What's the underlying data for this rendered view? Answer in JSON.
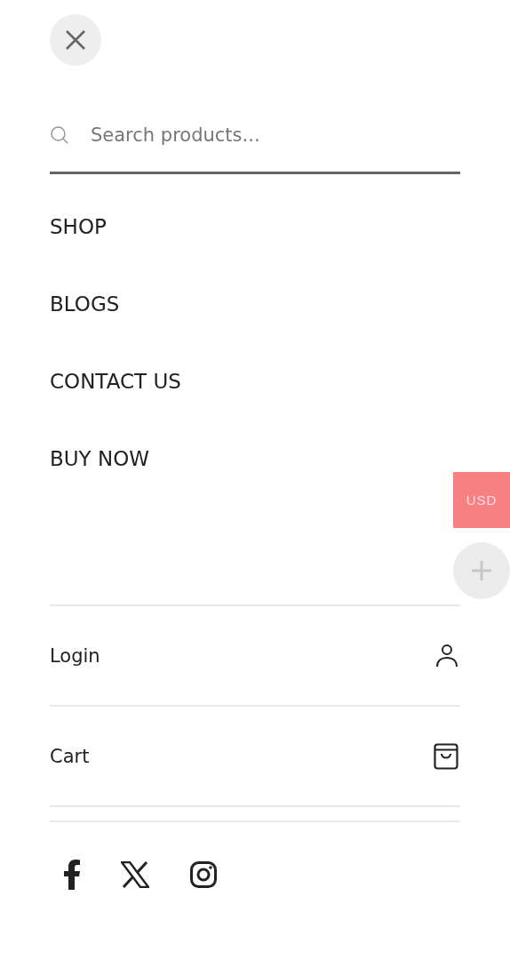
{
  "search": {
    "placeholder": "Search products..."
  },
  "menu": [
    {
      "label": "SHOP"
    },
    {
      "label": "BLOGS"
    },
    {
      "label": "CONTACT US"
    },
    {
      "label": "BUY NOW"
    }
  ],
  "account": [
    {
      "label": "Login",
      "kind": "user"
    },
    {
      "label": "Cart",
      "kind": "bag"
    }
  ],
  "social": [
    {
      "kind": "facebook"
    },
    {
      "kind": "x"
    },
    {
      "kind": "instagram"
    }
  ],
  "currency": {
    "label": "USD"
  }
}
